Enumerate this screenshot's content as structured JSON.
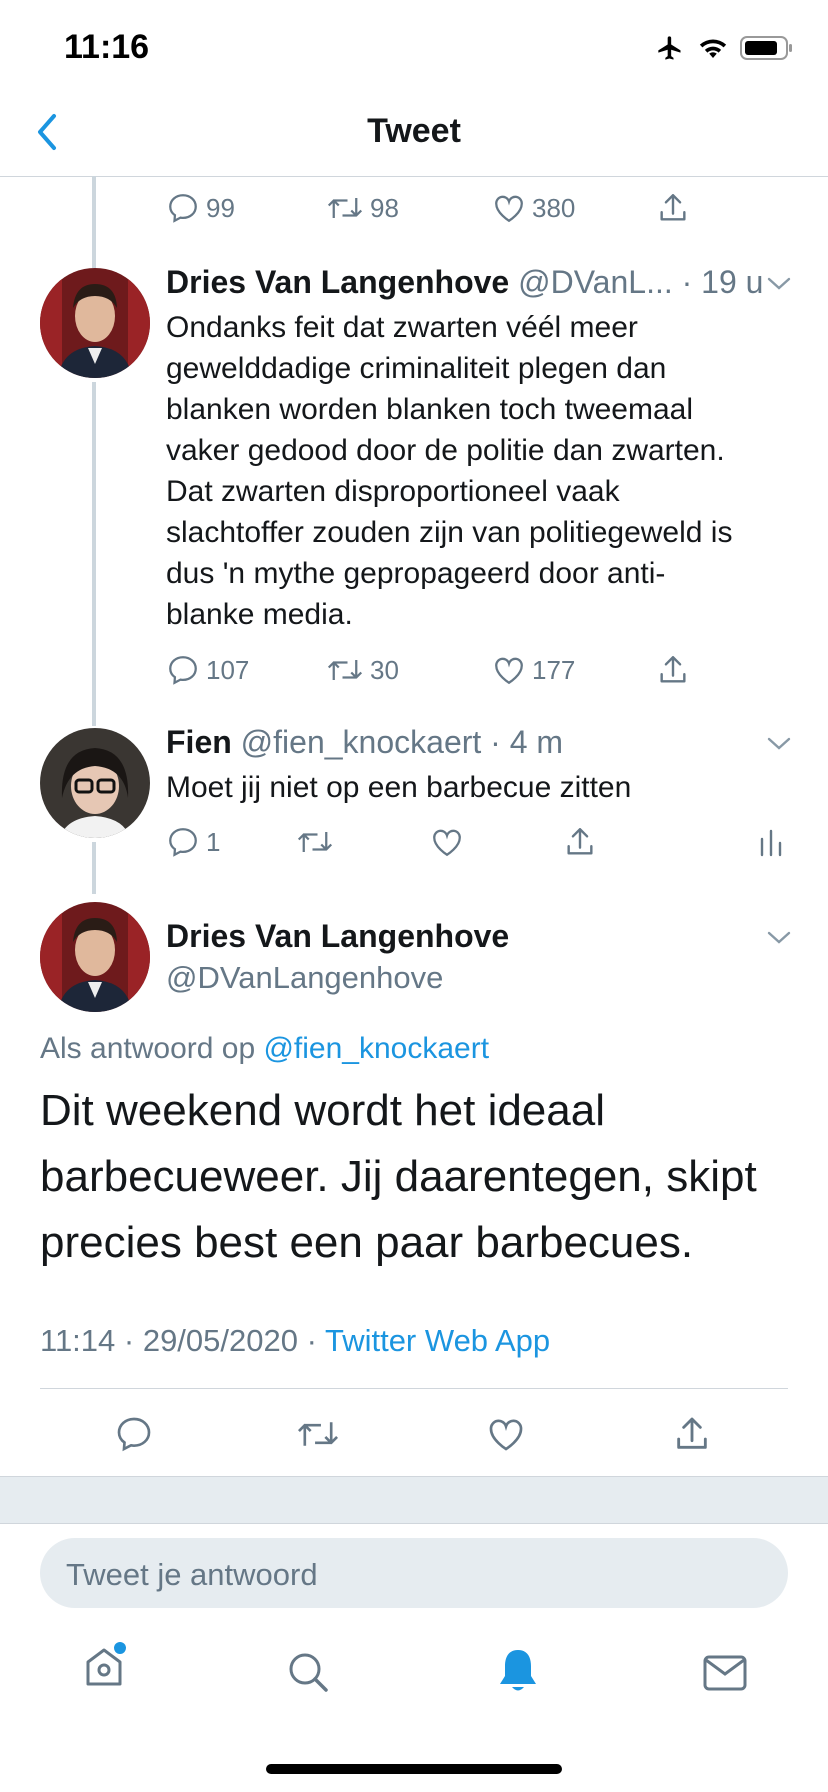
{
  "status_bar": {
    "time": "11:16"
  },
  "nav": {
    "title": "Tweet"
  },
  "colors": {
    "accent": "#1b95e0",
    "muted": "#657786",
    "text": "#14171a"
  },
  "parent_actions": {
    "replies": "99",
    "retweets": "98",
    "likes": "380"
  },
  "tweet1": {
    "name": "Dries Van Langenhove",
    "handle": "@DVanL...",
    "time": "· 19 u",
    "text_lines": [
      "Ondanks feit dat zwarten véél meer",
      "gewelddadige criminaliteit plegen dan",
      "blanken worden blanken toch tweemaal",
      "vaker gedood door de politie dan zwarten.",
      "Dat zwarten disproportioneel vaak",
      "slachtoffer zouden zijn van politiegeweld is",
      "dus 'n mythe gepropageerd door anti-",
      "blanke media."
    ],
    "replies": "107",
    "retweets": "30",
    "likes": "177"
  },
  "tweet2": {
    "name": "Fien",
    "handle": "@fien_knockaert",
    "time": "· 4 m",
    "text": "Moet jij niet op een barbecue zitten",
    "replies": "1"
  },
  "main": {
    "name": "Dries Van Langenhove",
    "handle": "@DVanLangenhove",
    "reply_prefix": "Als antwoord op ",
    "reply_to": "@fien_knockaert",
    "text_lines": [
      "Dit weekend wordt het ideaal",
      "barbecueweer. Jij daarentegen, skipt",
      "precies best een paar barbecues."
    ],
    "timestamp": "11:14 · 29/05/2020 · ",
    "source": "Twitter Web App"
  },
  "reply_input": {
    "placeholder": "Tweet je antwoord"
  },
  "tab_bar": {
    "icons": [
      "home-icon",
      "search-icon",
      "notifications-icon",
      "messages-icon"
    ],
    "active": "notifications-icon"
  }
}
